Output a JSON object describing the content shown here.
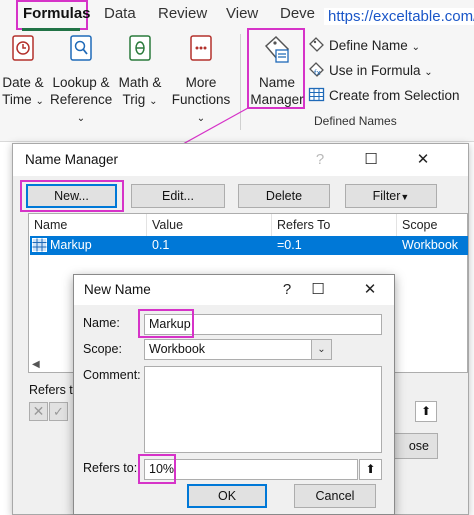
{
  "ribbon": {
    "tabs": [
      "Formulas",
      "Data",
      "Review",
      "View",
      "Deve"
    ],
    "url": "https://exceltable.com/",
    "buttons": [
      {
        "line1": "Date &",
        "line2": "Time"
      },
      {
        "line1": "Lookup &",
        "line2": "Reference"
      },
      {
        "line1": "Math &",
        "line2": "Trig"
      },
      {
        "line1": "More",
        "line2": "Functions"
      }
    ],
    "name_manager": {
      "line1": "Name",
      "line2": "Manager"
    },
    "define_name": "Define Name",
    "use_in_formula": "Use in Formula",
    "create_from_selection": "Create from Selection",
    "group_label": "Defined Names",
    "dropdown_caret": "⌄",
    "accent": "#217346",
    "highlight": "#d633c8"
  },
  "name_manager_dialog": {
    "title": "Name Manager",
    "buttons": {
      "new": "New...",
      "edit": "Edit...",
      "delete": "Delete",
      "filter": "Filter"
    },
    "columns": [
      "Name",
      "Value",
      "Refers To",
      "Scope"
    ],
    "rows": [
      {
        "name": "Markup",
        "value": "0.1",
        "refers_to": "=0.1",
        "scope": "Workbook"
      }
    ],
    "refers_to_label": "Refers to:",
    "close_partial": "ose",
    "selection_color": "#0078d7"
  },
  "new_name_dialog": {
    "title": "New Name",
    "name_label": "Name:",
    "name_value": "Markup",
    "scope_label": "Scope:",
    "scope_value": "Workbook",
    "comment_label": "Comment:",
    "refers_to_label": "Refers to:",
    "refers_to_value": "10%",
    "ok": "OK",
    "cancel": "Cancel"
  }
}
